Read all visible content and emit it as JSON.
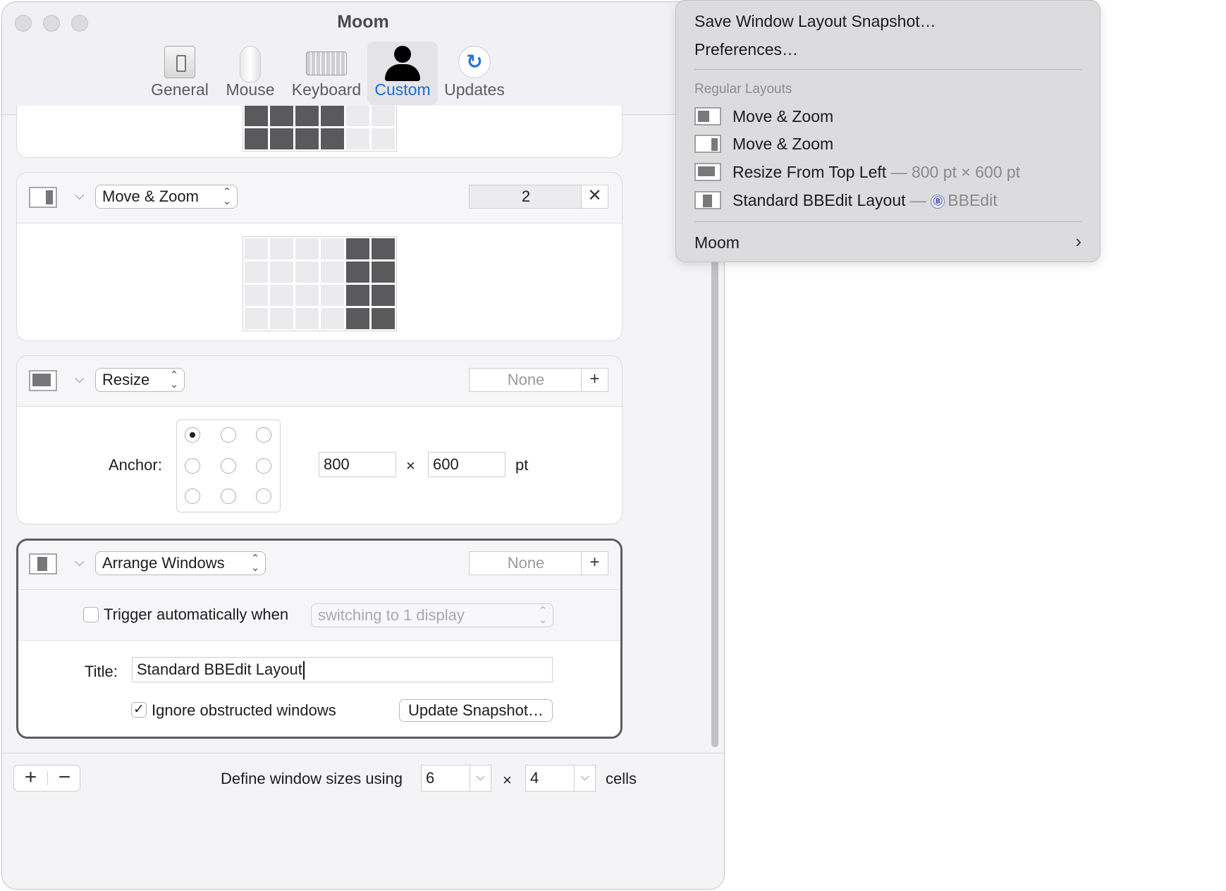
{
  "window": {
    "title": "Moom",
    "tabs": [
      {
        "label": "General",
        "icon": "general-switch-icon"
      },
      {
        "label": "Mouse",
        "icon": "mouse-icon"
      },
      {
        "label": "Keyboard",
        "icon": "keyboard-icon"
      },
      {
        "label": "Custom",
        "icon": "person-icon",
        "active": true
      },
      {
        "label": "Updates",
        "icon": "refresh-icon"
      }
    ],
    "update_glyph": "↻"
  },
  "panels": {
    "move_zoom": {
      "action": "Move & Zoom",
      "shortcut": "2",
      "clear_symbol": "✕"
    },
    "resize": {
      "action": "Resize",
      "shortcut": "None",
      "add_symbol": "+",
      "anchor_label": "Anchor:",
      "width": "800",
      "times": "×",
      "height": "600",
      "unit": "pt"
    },
    "arrange": {
      "action": "Arrange Windows",
      "shortcut": "None",
      "add_symbol": "+",
      "trigger_label": "Trigger automatically when",
      "trigger_option": "switching to 1 display",
      "title_label": "Title:",
      "title_value": "Standard BBEdit Layout",
      "ignore_label": "Ignore obstructed windows",
      "ignore_checked": "✓",
      "update_button": "Update Snapshot…"
    }
  },
  "bottom": {
    "add": "+",
    "remove": "−",
    "define_label": "Define window sizes using",
    "cols": "6",
    "times": "×",
    "rows": "4",
    "cells_label": "cells",
    "dropdown_glyph": "⌵"
  },
  "menu": {
    "items": [
      {
        "label": "Save Window Layout Snapshot…"
      },
      {
        "label": "Preferences…"
      }
    ],
    "section_header": "Regular Layouts",
    "layouts": [
      {
        "label": "Move & Zoom",
        "detail": ""
      },
      {
        "label": "Move & Zoom",
        "detail": ""
      },
      {
        "label": "Resize From Top Left",
        "detail": "— 800 pt × 600 pt"
      },
      {
        "label": "Standard BBEdit Layout",
        "dash": "—",
        "app_icon": "Ⓑ",
        "app": "BBEdit"
      }
    ],
    "submenu": {
      "label": "Moom",
      "arrow": "›"
    }
  },
  "colors": {
    "accent": "#1a6fd6",
    "grid_on": "#5a5a5c",
    "grid_off": "#ebebed",
    "menu_bg": "#dcdcde"
  }
}
